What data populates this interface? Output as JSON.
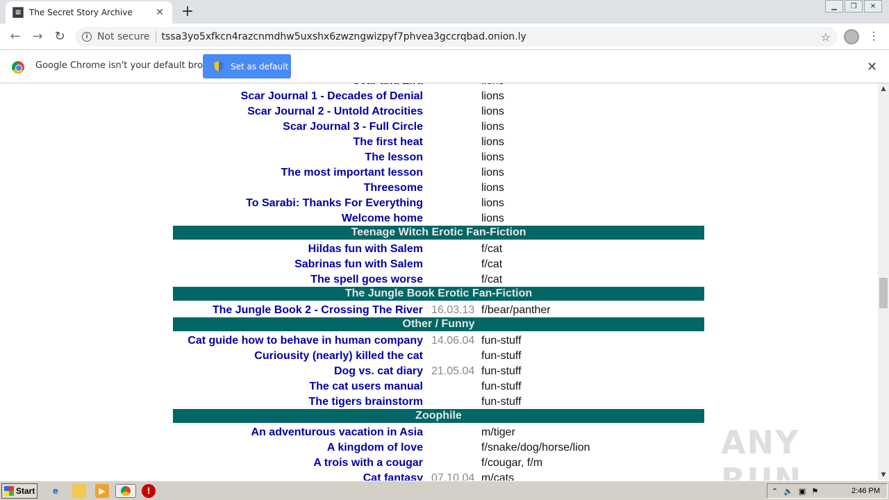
{
  "browser": {
    "tab_title": "The Secret Story Archive",
    "not_secure": "Not secure",
    "url": "tssa3yo5xfkcn4razcnmdhw5uxshx6zwzngwizpyf7phvea3gccrqbad.onion.ly",
    "infobar_text": "Google Chrome isn't your default browser",
    "set_default_label": "Set as default"
  },
  "rows": [
    {
      "title": "Scar Journal 1 - Decades of Denial",
      "date": "",
      "cat": "lions"
    },
    {
      "title": "Scar Journal 2 - Untold Atrocities",
      "date": "",
      "cat": "lions"
    },
    {
      "title": "Scar Journal 3 - Full Circle",
      "date": "",
      "cat": "lions"
    },
    {
      "title": "The first heat",
      "date": "",
      "cat": "lions"
    },
    {
      "title": "The lesson",
      "date": "",
      "cat": "lions"
    },
    {
      "title": "The most important lesson",
      "date": "",
      "cat": "lions"
    },
    {
      "title": "Threesome",
      "date": "",
      "cat": "lions"
    },
    {
      "title": "To Sarabi: Thanks For Everything",
      "date": "",
      "cat": "lions"
    },
    {
      "title": "Welcome home",
      "date": "",
      "cat": "lions"
    },
    {
      "header": "Teenage Witch Erotic Fan-Fiction"
    },
    {
      "title": "Hildas fun with Salem",
      "date": "",
      "cat": "f/cat"
    },
    {
      "title": "Sabrinas fun with Salem",
      "date": "",
      "cat": "f/cat"
    },
    {
      "title": "The spell goes worse",
      "date": "",
      "cat": "f/cat"
    },
    {
      "header": "The Jungle Book Erotic Fan-Fiction"
    },
    {
      "title": "The Jungle Book 2 - Crossing The River",
      "date": "16.03.13",
      "cat": "f/bear/panther"
    },
    {
      "header": "Other / Funny"
    },
    {
      "title": "Cat guide how to behave in human company",
      "date": "14.06.04",
      "cat": "fun-stuff"
    },
    {
      "title": "Curiousity (nearly) killed the cat",
      "date": "",
      "cat": "fun-stuff"
    },
    {
      "title": "Dog vs. cat diary",
      "date": "21.05.04",
      "cat": "fun-stuff"
    },
    {
      "title": "The cat users manual",
      "date": "",
      "cat": "fun-stuff"
    },
    {
      "title": "The tigers brainstorm",
      "date": "",
      "cat": "fun-stuff"
    },
    {
      "header": "Zoophile"
    },
    {
      "title": "An adventurous vacation in Asia",
      "date": "",
      "cat": "m/tiger"
    },
    {
      "title": "A kingdom of love",
      "date": "",
      "cat": "f/snake/dog/horse/lion"
    },
    {
      "title": "A trois with a cougar",
      "date": "",
      "cat": "f/cougar, f/m"
    },
    {
      "title": "Cat fantasy",
      "date": "07.10.04",
      "cat": "m/cats"
    }
  ],
  "partial_top": {
    "title": "Scar and Zira",
    "cat": "lions"
  },
  "watermark": "ANY RUN",
  "taskbar": {
    "start_label": "Start",
    "clock": "2:46 PM"
  },
  "icons": [
    "favicon",
    "close-icon",
    "plus-icon",
    "back-icon",
    "forward-icon",
    "reload-icon",
    "info-icon",
    "star-icon",
    "avatar",
    "kebab-menu-icon",
    "chrome-logo",
    "shield-icon"
  ]
}
